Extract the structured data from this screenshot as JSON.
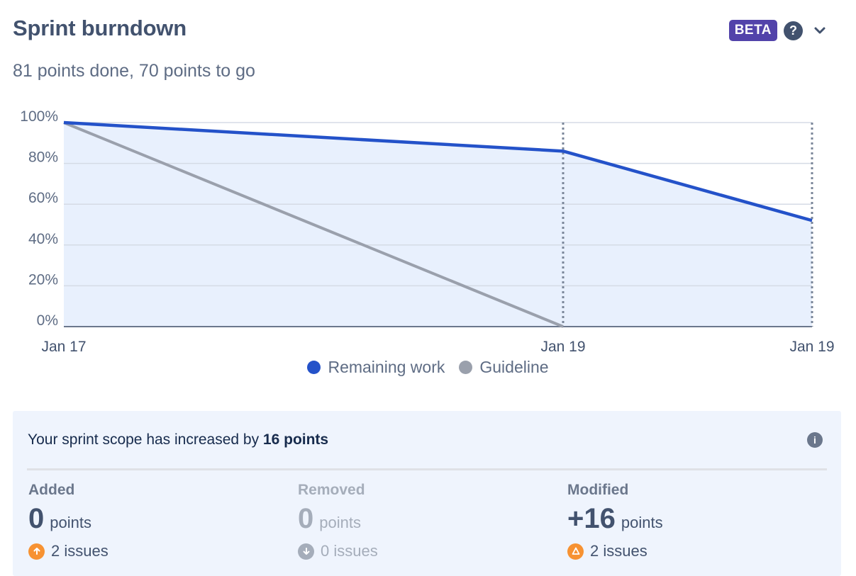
{
  "header": {
    "title": "Sprint burndown",
    "badge": "BETA",
    "help_icon": "question-circle-icon",
    "chevron_icon": "chevron-down-icon"
  },
  "summary": "81 points done, 70 points to go",
  "colors": {
    "remaining": "#2452c9",
    "guideline": "#9aa0ac",
    "area_fill": "#e8f0fd",
    "badge": "#5243aa",
    "added_icon": "#f79232",
    "modified_icon": "#f79232",
    "removed_icon": "#a5adba"
  },
  "chart_data": {
    "type": "line",
    "y_ticks": [
      "100%",
      "80%",
      "60%",
      "40%",
      "20%",
      "0%"
    ],
    "ylim": [
      0,
      100
    ],
    "x_ticks": [
      "Jan 17",
      "Jan 19",
      "Jan 19"
    ],
    "grid": true,
    "legend_position": "bottom-center",
    "series": [
      {
        "name": "Remaining work",
        "values": [
          100,
          86,
          52
        ]
      },
      {
        "name": "Guideline",
        "values": [
          100,
          0
        ]
      }
    ]
  },
  "legend": {
    "remaining": "Remaining work",
    "guideline": "Guideline"
  },
  "scope": {
    "text_prefix": "Your sprint scope has increased by ",
    "text_bold": "16 points",
    "info_icon": "info-icon",
    "added": {
      "label": "Added",
      "value": "0",
      "unit": "points",
      "issues": "2 issues",
      "icon": "arrow-up-circle-icon"
    },
    "removed": {
      "label": "Removed",
      "value": "0",
      "unit": "points",
      "issues": "0 issues",
      "icon": "arrow-down-circle-icon"
    },
    "modified": {
      "label": "Modified",
      "value": "+16",
      "unit": "points",
      "issues": "2 issues",
      "icon": "delta-circle-icon"
    }
  }
}
